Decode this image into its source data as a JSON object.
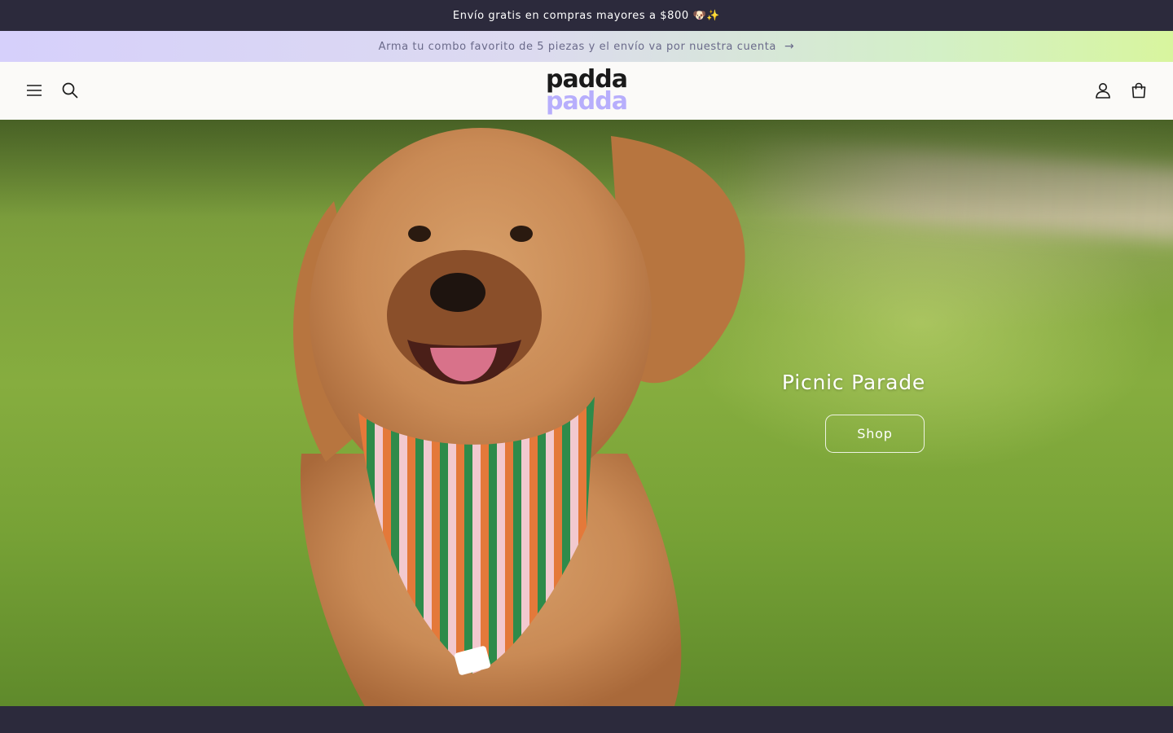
{
  "announcement": {
    "text": "Envío gratis en compras mayores a $800 🐶✨"
  },
  "promo": {
    "text": "Arma tu combo favorito de 5 piezas y el envío va por nuestra cuenta",
    "arrow": "→"
  },
  "header": {
    "logo_line1": "padda",
    "logo_line2": "padda",
    "icons": [
      "menu-icon",
      "search-icon",
      "account-icon",
      "cart-icon"
    ]
  },
  "hero": {
    "title": "Picnic Parade",
    "button_label": "Shop"
  },
  "colors": {
    "dark": "#2c2a3c",
    "header_bg": "#fbfaf8",
    "logo_accent": "#b7aefc",
    "promo_start": "#d6d0fb",
    "promo_end": "#d8f59e"
  }
}
